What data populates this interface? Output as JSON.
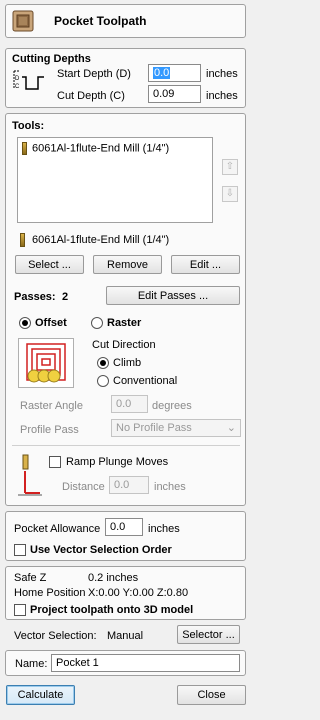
{
  "header": {
    "title": "Pocket Toolpath"
  },
  "cutting_depths": {
    "title": "Cutting Depths",
    "start_label": "Start Depth (D)",
    "start_value": "0.0",
    "start_unit": "inches",
    "cut_label": "Cut Depth (C)",
    "cut_value": "0.09",
    "cut_unit": "inches"
  },
  "tools": {
    "title": "Tools:",
    "list_items": [
      "6061Al-1flute-End Mill (1/4\")"
    ],
    "selected_tool": "6061Al-1flute-End Mill (1/4\")",
    "select_label": "Select ...",
    "remove_label": "Remove",
    "edit_label": "Edit ..."
  },
  "passes": {
    "label": "Passes:",
    "count": "2",
    "edit_label": "Edit Passes ..."
  },
  "strategy": {
    "offset_label": "Offset",
    "raster_label": "Raster",
    "cut_direction_label": "Cut Direction",
    "climb_label": "Climb",
    "conventional_label": "Conventional",
    "raster_angle_label": "Raster Angle",
    "raster_angle_value": "0.0",
    "raster_angle_unit": "degrees",
    "profile_pass_label": "Profile Pass",
    "profile_pass_value": "No Profile Pass"
  },
  "ramp": {
    "label": "Ramp Plunge Moves",
    "distance_label": "Distance",
    "distance_value": "0.0",
    "distance_unit": "inches"
  },
  "allowance": {
    "label": "Pocket Allowance",
    "value": "0.0",
    "unit": "inches",
    "vector_order_label": "Use Vector Selection Order"
  },
  "info": {
    "safe_z_label": "Safe Z",
    "safe_z_value": "0.2 inches",
    "home_label": "Home Position",
    "home_value": "X:0.00 Y:0.00 Z:0.80",
    "project_label": "Project toolpath onto 3D model"
  },
  "vector_selection": {
    "label": "Vector Selection:",
    "value": "Manual",
    "selector_label": "Selector ..."
  },
  "name": {
    "label": "Name:",
    "value": "Pocket 1"
  },
  "footer": {
    "calculate_label": "Calculate",
    "close_label": "Close"
  },
  "colors": {
    "accent": "#3399ff",
    "icon_red": "#d22020",
    "icon_yellow": "#f0d040"
  }
}
